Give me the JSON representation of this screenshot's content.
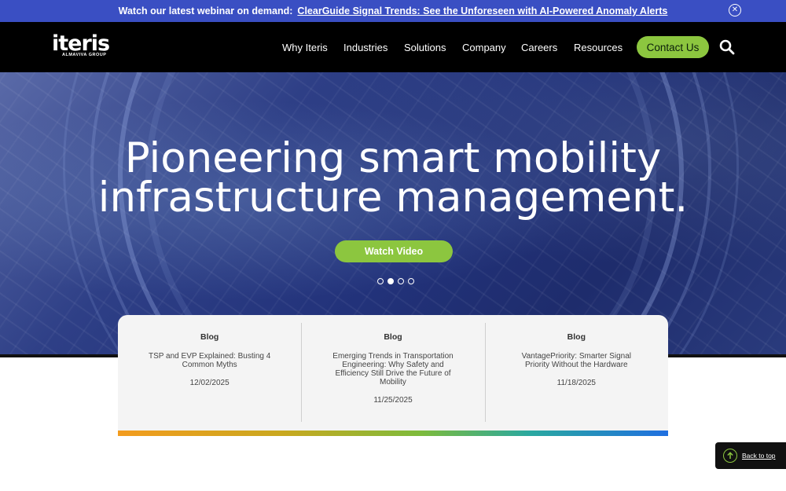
{
  "announcement": {
    "prefix": "Watch our latest webinar on demand:",
    "link": "ClearGuide Signal Trends: See the Unforeseen with AI-Powered Anomaly Alerts",
    "close_icon": "close-circle-icon"
  },
  "nav": {
    "logo_text": "iteris",
    "logo_sub": "ALMAVIVA GROUP",
    "items": [
      "Why Iteris",
      "Industries",
      "Solutions",
      "Company",
      "Careers",
      "Resources"
    ],
    "cta": "Contact Us",
    "search_icon": "search-icon"
  },
  "hero": {
    "headline_line1": "Pioneering smart mobility",
    "headline_line2": "infrastructure management.",
    "button": "Watch Video",
    "slides": 4,
    "active_slide": 2
  },
  "blog_cards": [
    {
      "category": "Blog",
      "title": "TSP and EVP Explained: Busting 4 Common Myths",
      "date": "12/02/2025"
    },
    {
      "category": "Blog",
      "title": "Emerging Trends in Transportation Engineering: Why Safety and Efficiency Still Drive the Future of Mobility",
      "date": "11/25/2025"
    },
    {
      "category": "Blog",
      "title": "VantagePriority: Smarter Signal Priority Without the Hardware",
      "date": "11/18/2025"
    }
  ],
  "back_to_top": {
    "label": "Back to top",
    "icon": "arrow-up-circle-icon"
  },
  "colors": {
    "accent_green": "#8cc63f",
    "announce_blue": "#3a4fc3",
    "nav_black": "#000000"
  }
}
